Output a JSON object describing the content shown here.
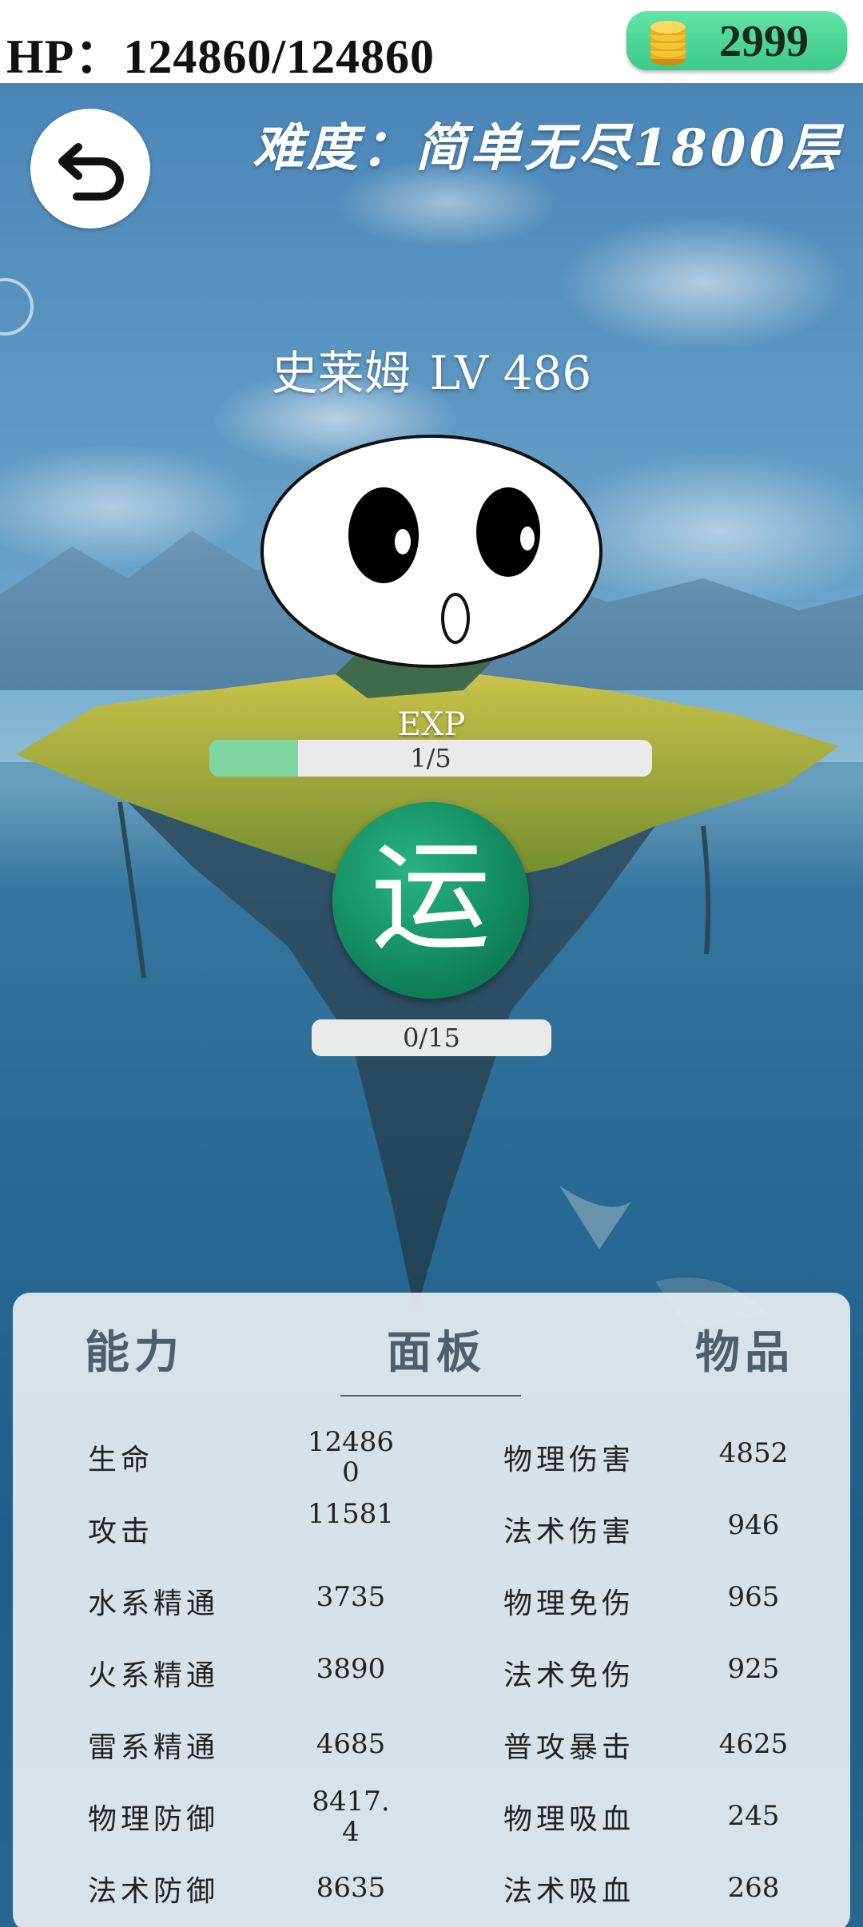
{
  "topbar": {
    "hp_text": "HP：124860/124860",
    "coins": "2999"
  },
  "scene": {
    "difficulty": "难度：简单无尽1800层",
    "monster_name": "史莱姆",
    "monster_level": "LV 486",
    "exp_label": "EXP",
    "exp_text": "1/5",
    "exp_fraction": 0.2,
    "action_button": "运",
    "cooldown_text": "0/15",
    "cooldown_fraction": 0
  },
  "panel": {
    "tabs": [
      "能力",
      "面板",
      "物品"
    ],
    "active_tab": "面板",
    "left_stats": [
      {
        "label": "生命",
        "value": "124860"
      },
      {
        "label": "攻击",
        "value": "11581"
      },
      {
        "label": "水系精通",
        "value": "3735"
      },
      {
        "label": "火系精通",
        "value": "3890"
      },
      {
        "label": "雷系精通",
        "value": "4685"
      },
      {
        "label": "物理防御",
        "value": "8417.4"
      },
      {
        "label": "法术防御",
        "value": "8635"
      }
    ],
    "right_stats": [
      {
        "label": "物理伤害",
        "value": "4852"
      },
      {
        "label": "法术伤害",
        "value": "946"
      },
      {
        "label": "物理免伤",
        "value": "965"
      },
      {
        "label": "法术免伤",
        "value": "925"
      },
      {
        "label": "普攻暴击",
        "value": "4625"
      },
      {
        "label": "物理吸血",
        "value": "245"
      },
      {
        "label": "法术吸血",
        "value": "268"
      }
    ]
  },
  "colors": {
    "coin_box": "#4fd79a",
    "exp_fill": "#7fd6a0",
    "action_button": "#119166"
  },
  "icons": {
    "back": "return-arrow-icon",
    "coin": "gold-coin-stack-icon"
  }
}
